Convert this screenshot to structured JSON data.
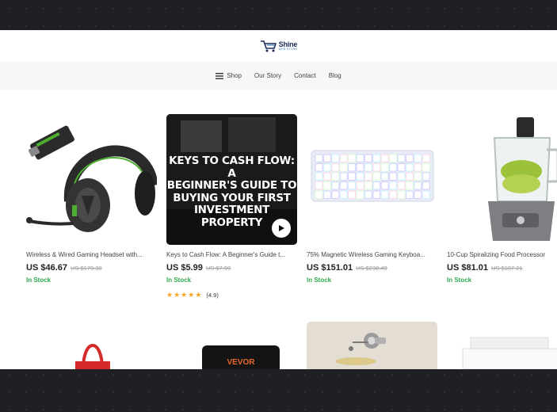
{
  "header": {
    "logo_name": "Shine",
    "logo_sub": "WEB STORE"
  },
  "nav": {
    "items": [
      "Shop",
      "Our Story",
      "Contact",
      "Blog"
    ]
  },
  "products": [
    {
      "title": "Wireless & Wired Gaming Headset with...",
      "price": "US $46.67",
      "old_price": "US $179.30",
      "stock": "In Stock"
    },
    {
      "title": "Keys to Cash Flow: A Beginner's Guide t...",
      "price": "US $5.99",
      "old_price": "US $7.99",
      "stock": "In Stock",
      "rating": "(4.9)",
      "cover_text": "KEYS TO CASH FLOW: A BEGINNER'S GUIDE TO BUYING YOUR FIRST INVESTMENT PROPERTY",
      "cover_lines": [
        "KEYS TO CASH FLOW: A",
        "BEGINNER'S GUIDE TO",
        "BUYING YOUR FIRST",
        "INVESTMENT PROPERTY"
      ]
    },
    {
      "title": "75% Magnetic Wireless Gaming Keyboa...",
      "price": "US $151.01",
      "old_price": "US $238.49",
      "stock": "In Stock"
    },
    {
      "title": "10-Cup Spiralizing Food Processor",
      "price": "US $81.01",
      "old_price": "US $187.21",
      "stock": "In Stock"
    }
  ],
  "row2": {
    "vevor_label": "VEVOR"
  },
  "colors": {
    "accent_green": "#2fa84f",
    "star": "#f5a623",
    "brand_navy": "#1c2a55"
  }
}
